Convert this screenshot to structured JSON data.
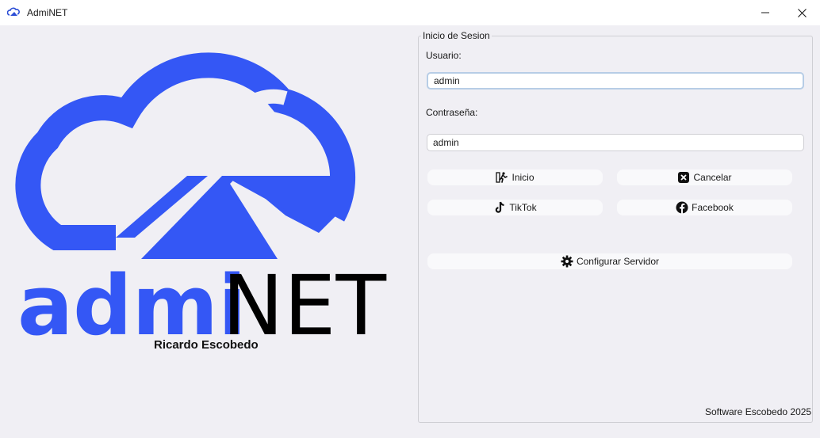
{
  "window": {
    "title": "AdmiNET",
    "icon": "cloud-app-icon",
    "controls": [
      "minimize-icon",
      "close-icon"
    ]
  },
  "logo": {
    "word_blue": "admi",
    "word_black": "NET",
    "author": "Ricardo Escobedo",
    "brand_color": "#3457f5",
    "text_color": "#000000"
  },
  "login": {
    "group_title": "Inicio de Sesion",
    "username_label": "Usuario:",
    "username_value": "admin",
    "password_label": "Contraseña:",
    "password_value": "admin"
  },
  "buttons": {
    "inicio": {
      "label": "Inicio",
      "icon": "running-person-icon"
    },
    "cancelar": {
      "label": "Cancelar",
      "icon": "x-square-icon"
    },
    "tiktok": {
      "label": "TikTok",
      "icon": "tiktok-icon"
    },
    "facebook": {
      "label": "Facebook",
      "icon": "facebook-icon"
    },
    "config": {
      "label": "Configurar Servidor",
      "icon": "gear-icon"
    }
  },
  "footer": "Software Escobedo 2025"
}
